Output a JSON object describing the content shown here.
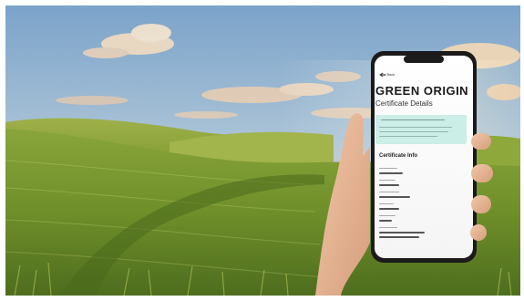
{
  "phone": {
    "back_label": "Go Back",
    "brand": "GREEN ORIGIN",
    "subtitle": "Certificate Details",
    "section_title": "Certificate Info"
  },
  "colors": {
    "sky_top": "#7da7cd",
    "sky_horizon": "#f0d7b4",
    "field_green": "#6f8f2a",
    "notice_bg": "#cbeee6",
    "phone_body": "#1b1b1b"
  },
  "icons": {
    "back": "arrow-left-icon",
    "notice": "leaf-icon"
  }
}
